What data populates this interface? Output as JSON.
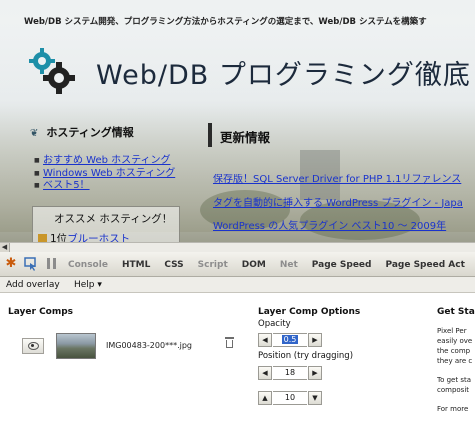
{
  "webpage": {
    "topbar_text": "Web/DB システム開発、プログラミング方法からホスティングの選定まで、Web/DB システムを構築す",
    "site_title": "Web/DB プログラミング徹底",
    "hosting_heading": "ホスティング情報",
    "hosting_links": [
      "おすすめ Web ホスティング",
      "Windows Web ホスティング",
      "ベスト5！"
    ],
    "promo_title": "オススメ ホスティング！",
    "promo_rank": "1位",
    "promo_rank_link": "ブルーホスト",
    "updates_heading": "更新情報",
    "updates": [
      "保存版！SQL Server Driver for PHP 1.1リファレンス",
      "タグを自動的に挿入する WordPress プラグイン - Japa",
      "WordPress の人気プラグイン ベスト10 ～ 2009年"
    ]
  },
  "firebug": {
    "tabs": [
      {
        "label": "Console",
        "enabled": false
      },
      {
        "label": "HTML",
        "enabled": true
      },
      {
        "label": "CSS",
        "enabled": true
      },
      {
        "label": "Script",
        "enabled": false
      },
      {
        "label": "DOM",
        "enabled": true
      },
      {
        "label": "Net",
        "enabled": false
      },
      {
        "label": "Page Speed",
        "enabled": true
      },
      {
        "label": "Page Speed Act",
        "enabled": true
      }
    ],
    "menu": {
      "add_overlay": "Add overlay",
      "help": "Help ▾"
    }
  },
  "layer_comps": {
    "heading": "Layer Comps",
    "layer_name": "IMG00483-200***.jpg"
  },
  "options": {
    "heading": "Layer Comp Options",
    "opacity_label": "Opacity",
    "opacity_value": "0.5",
    "position_label": "Position (try dragging)",
    "position_x": "18",
    "position_y": "10"
  },
  "getting_started": {
    "heading": "Get Star",
    "lines": [
      "Pixel Per",
      "easily ove",
      "the comp",
      "they are c",
      "",
      "To get sta",
      "composit",
      "",
      "For more"
    ]
  },
  "colors": {
    "link": "#1a33cc",
    "selection": "#3165c9",
    "firebug_bug": "#c95b0c"
  }
}
